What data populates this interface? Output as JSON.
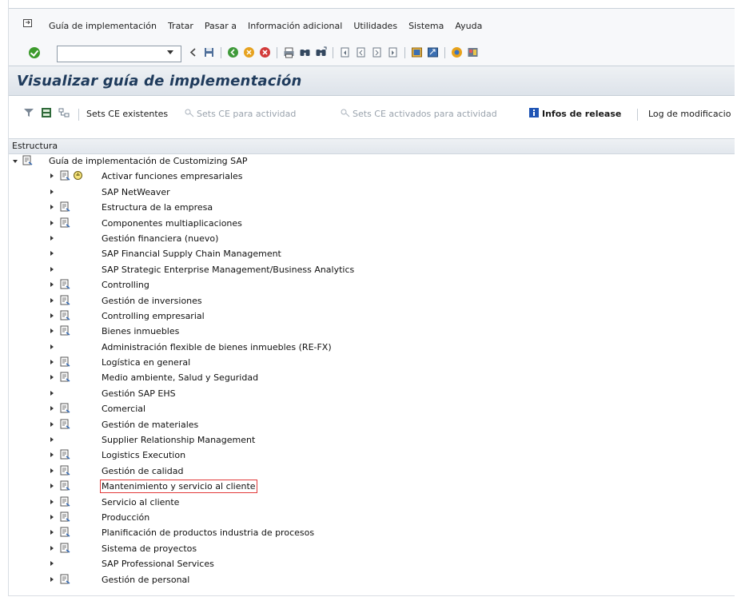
{
  "menu": [
    "Guía de implementación",
    "Tratar",
    "Pasar a",
    "Información adicional",
    "Utilidades",
    "Sistema",
    "Ayuda"
  ],
  "menu_icon": "document-arrow-icon",
  "toolbar": {
    "command_field_value": "",
    "icons": [
      "back-icon",
      "save-icon",
      "nav-back-icon",
      "exit-icon",
      "cancel-icon",
      "print-icon",
      "find-icon",
      "find-next-icon",
      "first-page-icon",
      "prev-page-icon",
      "next-page-icon",
      "last-page-icon",
      "new-session-icon",
      "shortcut-icon",
      "help-icon",
      "layout-icon"
    ]
  },
  "title": "Visualizar guía de implementación",
  "app_toolbar": {
    "sets_ce_existentes": "Sets CE existentes",
    "sets_ce_actividad": "Sets CE para actividad",
    "sets_ce_activados": "Sets CE activados para actividad",
    "infos_release": "Infos de release",
    "log_modificaciones": "Log de modificacio"
  },
  "tree_header": "Estructura",
  "tree_root": "Guía de implementación de Customizing SAP",
  "tree_items": [
    {
      "label": "Activar funciones empresariales",
      "icon": true,
      "bulb": true
    },
    {
      "label": "SAP NetWeaver",
      "icon": false
    },
    {
      "label": "Estructura de la empresa",
      "icon": true
    },
    {
      "label": "Componentes multiaplicaciones",
      "icon": true
    },
    {
      "label": "Gestión financiera (nuevo)",
      "icon": false
    },
    {
      "label": "SAP Financial Supply Chain Management",
      "icon": false
    },
    {
      "label": "SAP Strategic Enterprise Management/Business Analytics",
      "icon": false
    },
    {
      "label": "Controlling",
      "icon": true
    },
    {
      "label": "Gestión de inversiones",
      "icon": true
    },
    {
      "label": "Controlling empresarial",
      "icon": true
    },
    {
      "label": "Bienes inmuebles",
      "icon": true
    },
    {
      "label": "Administración flexible de bienes inmuebles (RE-FX)",
      "icon": false
    },
    {
      "label": "Logística en general",
      "icon": true
    },
    {
      "label": "Medio ambiente, Salud y Seguridad",
      "icon": true
    },
    {
      "label": "Gestión SAP EHS",
      "icon": false
    },
    {
      "label": "Comercial",
      "icon": true
    },
    {
      "label": "Gestión de materiales",
      "icon": true
    },
    {
      "label": "Supplier Relationship Management",
      "icon": false
    },
    {
      "label": "Logistics Execution",
      "icon": true
    },
    {
      "label": "Gestión de calidad",
      "icon": true
    },
    {
      "label": "Mantenimiento y servicio al cliente",
      "icon": true,
      "highlight": true
    },
    {
      "label": "Servicio al cliente",
      "icon": true
    },
    {
      "label": "Producción",
      "icon": true
    },
    {
      "label": "Planificación de productos industria de procesos",
      "icon": true
    },
    {
      "label": "Sistema de proyectos",
      "icon": true
    },
    {
      "label": "SAP Professional Services",
      "icon": false
    },
    {
      "label": "Gestión de personal",
      "icon": true
    }
  ]
}
